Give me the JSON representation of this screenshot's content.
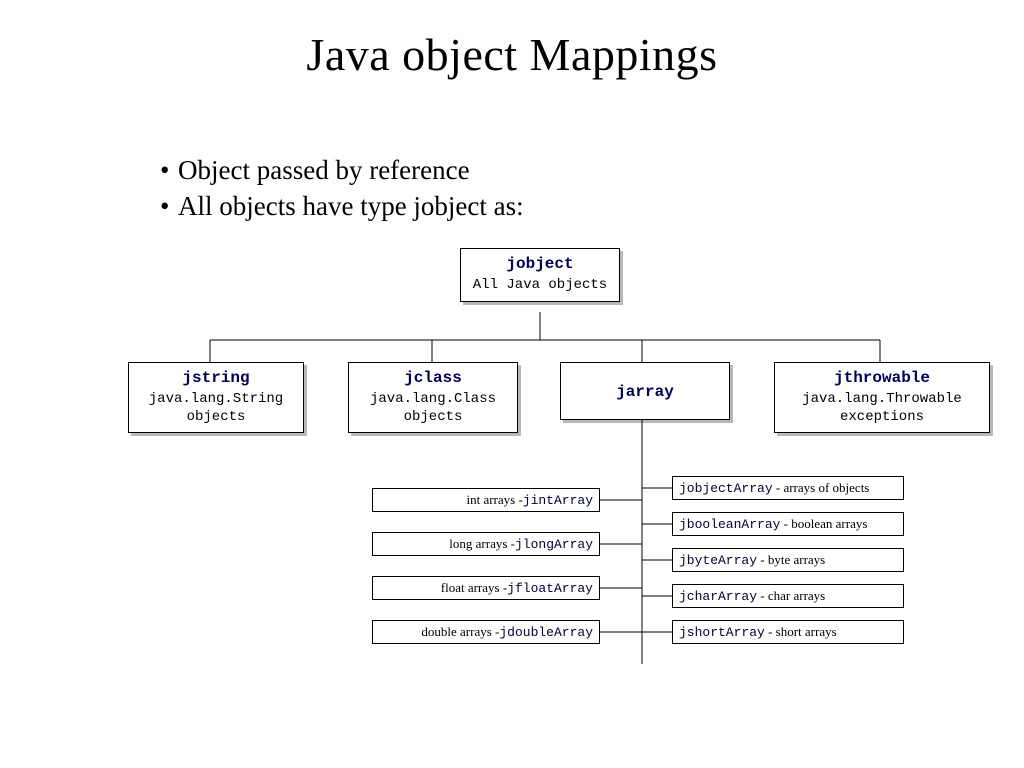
{
  "title": "Java object Mappings",
  "bullets": [
    "Object passed by reference",
    "All objects have type jobject as:"
  ],
  "root": {
    "label": "jobject",
    "desc": "All Java objects"
  },
  "children": [
    {
      "label": "jstring",
      "desc": "java.lang.String objects"
    },
    {
      "label": "jclass",
      "desc": "java.lang.Class objects"
    },
    {
      "label": "jarray",
      "desc": ""
    },
    {
      "label": "jthrowable",
      "desc": "java.lang.Throwable exceptions"
    }
  ],
  "arrays_left": [
    {
      "prefix": "int arrays -",
      "mono": "jintArray"
    },
    {
      "prefix": "long arrays -",
      "mono": "jlongArray"
    },
    {
      "prefix": "float arrays -",
      "mono": "jfloatArray"
    },
    {
      "prefix": "double arrays -",
      "mono": "jdoubleArray"
    }
  ],
  "arrays_right": [
    {
      "mono": "jobjectArray",
      "suffix": " - arrays of objects"
    },
    {
      "mono": "jbooleanArray",
      "suffix": " - boolean arrays"
    },
    {
      "mono": "jbyteArray",
      "suffix": " - byte arrays"
    },
    {
      "mono": "jcharArray",
      "suffix": " - char arrays"
    },
    {
      "mono": "jshortArray",
      "suffix": " - short arrays"
    }
  ]
}
